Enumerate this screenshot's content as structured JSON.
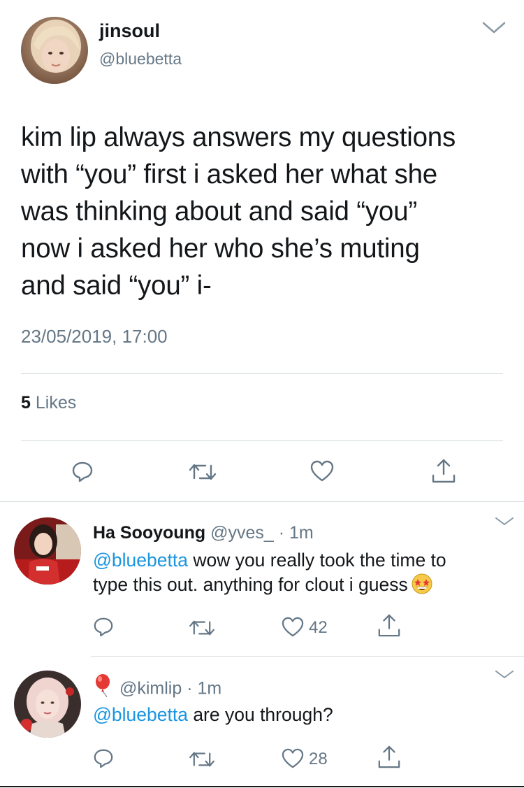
{
  "main_tweet": {
    "author_name": "jinsoul",
    "author_handle": "@bluebetta",
    "text_lines": [
      "kim lip always answers my questions",
      "with “you” first i asked her what she",
      "was thinking about and said “you”",
      "now i asked her who she’s muting",
      "and said “you” i-"
    ],
    "timestamp": "23/05/2019, 17:00",
    "likes_count": "5",
    "likes_label": "Likes",
    "actions": [
      "reply-icon",
      "retweet-icon",
      "like-icon",
      "share-icon"
    ]
  },
  "replies": [
    {
      "author_name": "Ha Sooyoung",
      "author_handle": "@yves_",
      "time": "· 1m",
      "mention": "@bluebetta",
      "text_line1": " wow you really took the time to",
      "text_line2": "type this out. anything for clout i guess",
      "emoji": "star-struck-emoji",
      "like_count": "42"
    },
    {
      "author_name": "",
      "author_icon": "red-balloon-emoji",
      "author_handle": "@kimlip",
      "time": "· 1m",
      "mention": "@bluebetta",
      "text_line1": " are you through?",
      "like_count": "28"
    }
  ],
  "colors": {
    "text": "#14171a",
    "secondary": "#657786",
    "link": "#1b95e0",
    "icon": "#657786",
    "divider": "#d3dade"
  }
}
